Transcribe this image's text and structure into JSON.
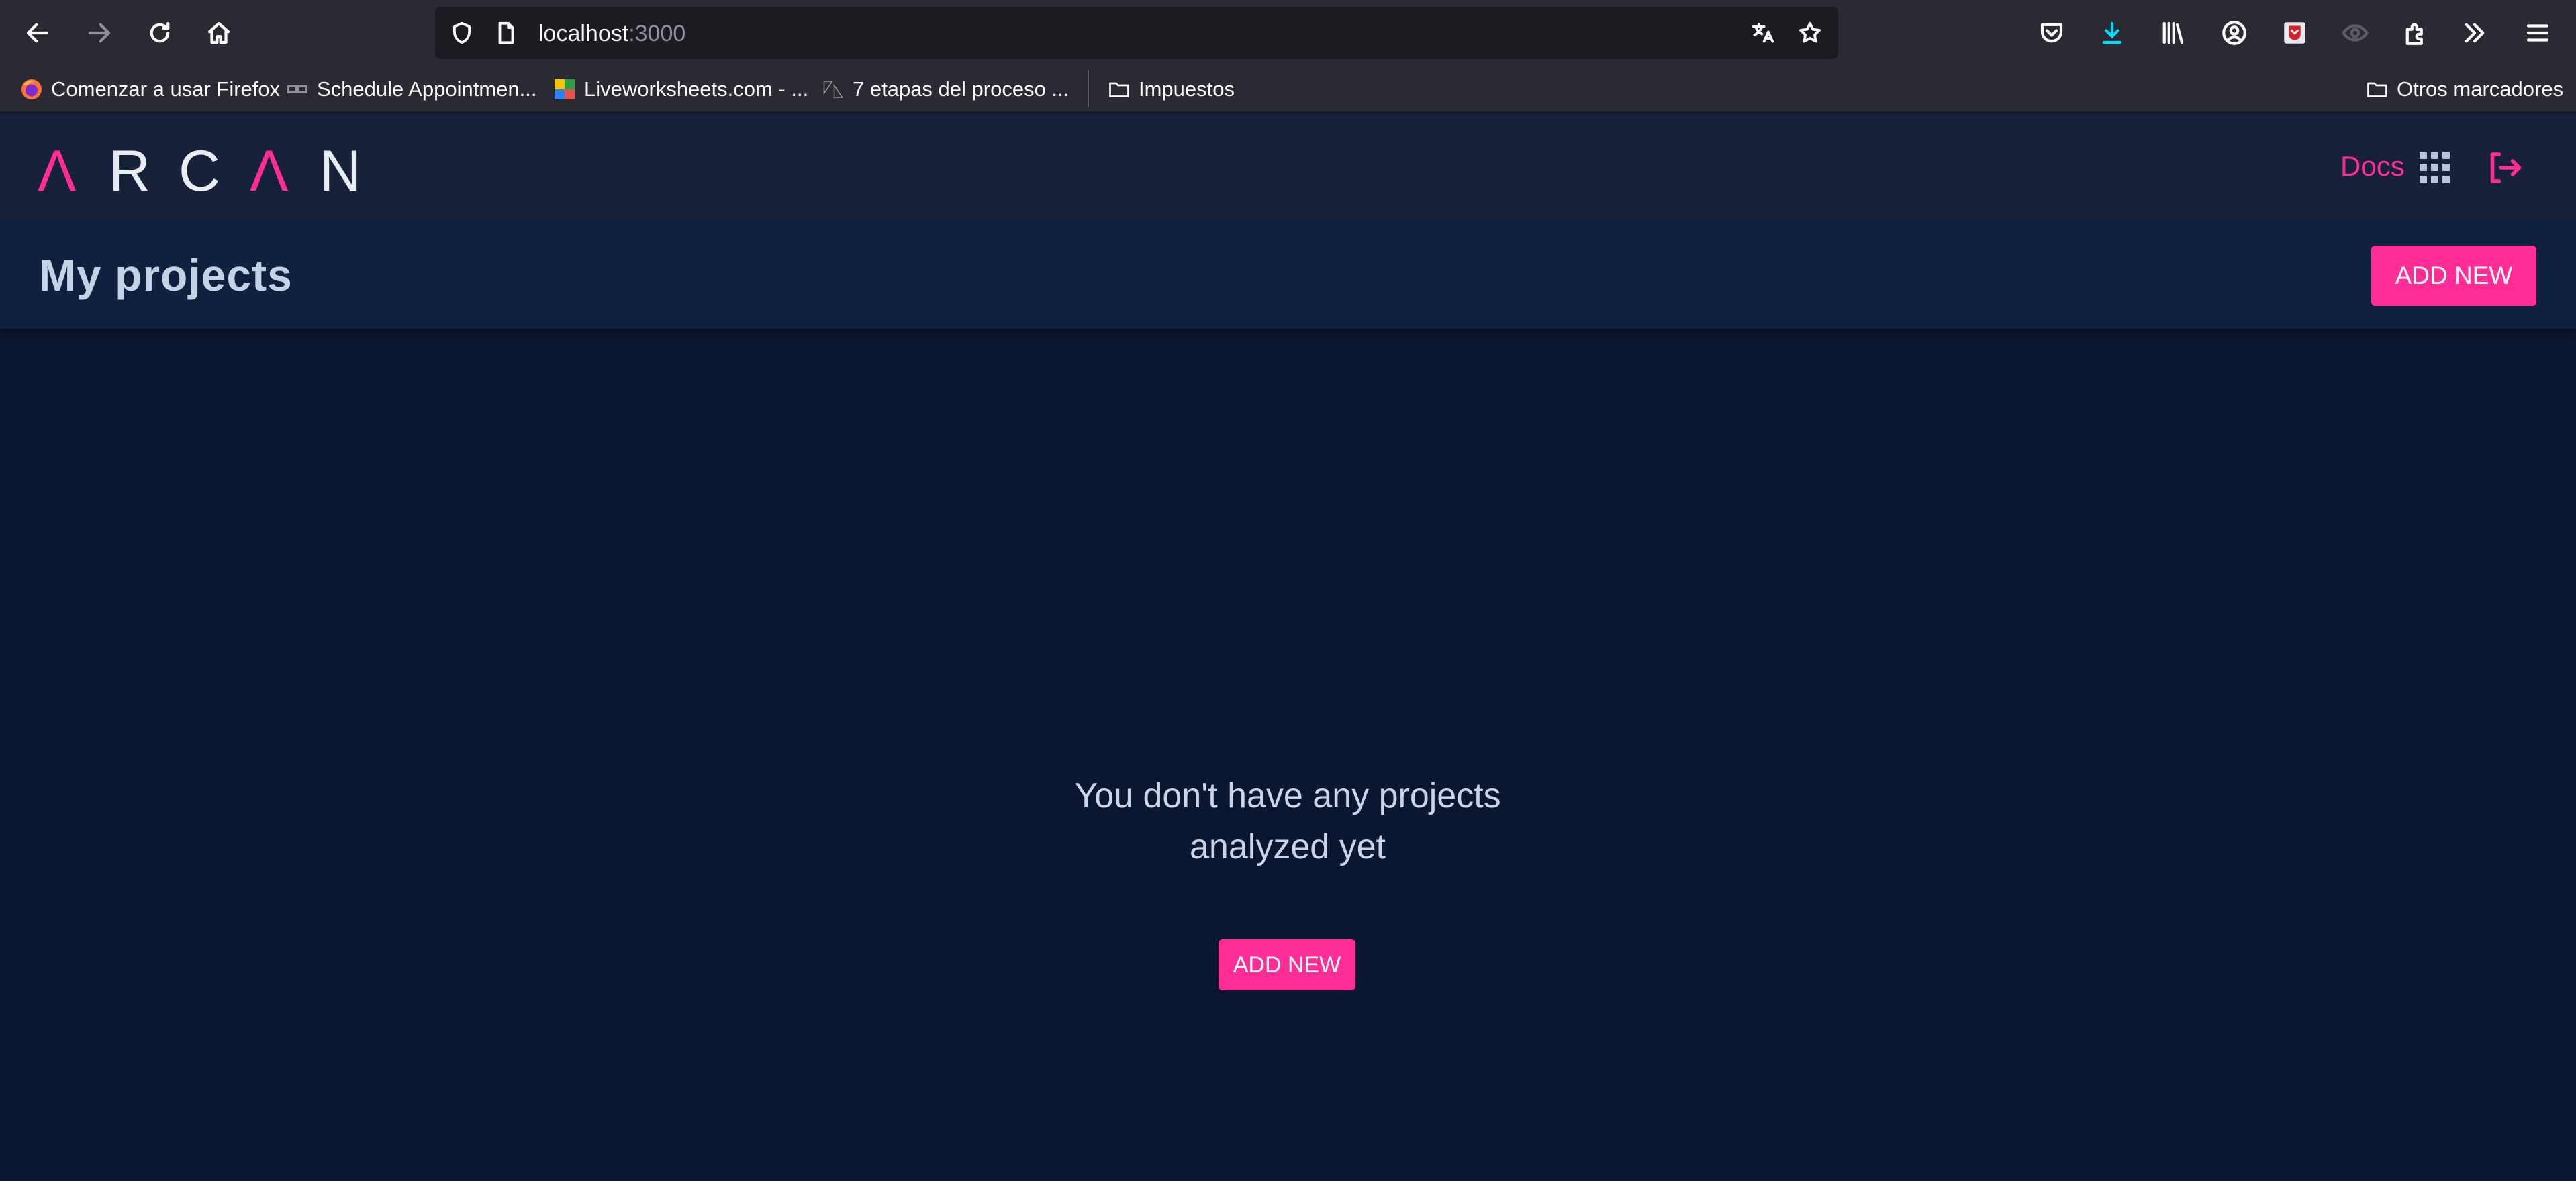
{
  "browser": {
    "url_host": "localhost",
    "url_port": ":3000",
    "bookmarks": [
      {
        "label": "Comenzar a usar Firefox",
        "icon": "firefox-icon"
      },
      {
        "label": "Schedule Appointmen...",
        "icon": "link-icon"
      },
      {
        "label": "Liveworksheets.com - ...",
        "icon": "liveworksheets-icon"
      },
      {
        "label": "7 etapas del proceso ...",
        "icon": "zendesk-icon"
      },
      {
        "label": "Impuestos",
        "icon": "folder-icon"
      }
    ],
    "other_bookmarks": "Otros marcadores"
  },
  "app": {
    "logo_letters": [
      "Λ",
      "R",
      "C",
      "Λ",
      "N"
    ],
    "nav": {
      "docs_label": "Docs"
    },
    "colors": {
      "accent": "#ff2d95",
      "background": "#0b1730",
      "header": "#18213a",
      "title_bar": "#10213f"
    }
  },
  "page": {
    "title": "My projects",
    "add_new_label": "ADD NEW",
    "empty_line1": "You don't have any projects",
    "empty_line2": "analyzed yet",
    "empty_add_new_label": "ADD NEW"
  }
}
